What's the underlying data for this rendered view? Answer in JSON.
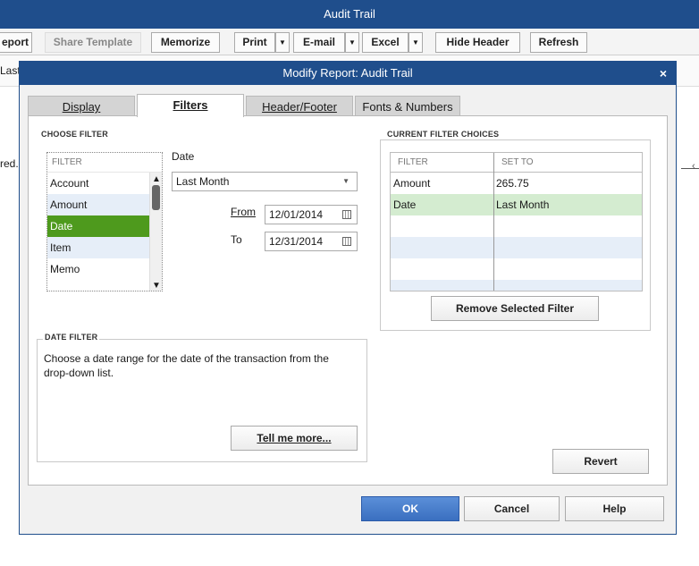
{
  "app": {
    "title": "Audit Trail",
    "toolbar": {
      "report": "eport",
      "share_template": "Share Template",
      "memorize": "Memorize",
      "print": "Print",
      "email": "E-mail",
      "excel": "Excel",
      "hide_header": "Hide Header",
      "refresh": "Refresh"
    },
    "bg_last": "Last",
    "bg_red": "red."
  },
  "dialog": {
    "title": "Modify Report: Audit Trail",
    "close": "×",
    "tabs": [
      {
        "label": "Display"
      },
      {
        "label": "Filters"
      },
      {
        "label": "Header/Footer"
      },
      {
        "label": "Fonts & Numbers"
      }
    ],
    "choose_filter": {
      "section_label": "CHOOSE FILTER",
      "list_header": "FILTER",
      "items": [
        "Account",
        "Amount",
        "Date",
        "Item",
        "Memo"
      ],
      "selected": "Date",
      "date_label": "Date",
      "date_range": "Last Month",
      "from_label": "From",
      "from_value": "12/01/2014",
      "to_label": "To",
      "to_value": "12/31/2014"
    },
    "date_filter": {
      "section_label": "DATE FILTER",
      "description": "Choose a date range for the date of the transaction from the drop-down list.",
      "tell_me_more": "Tell me more..."
    },
    "current_filters": {
      "section_label": "CURRENT FILTER CHOICES",
      "col_filter": "FILTER",
      "col_set_to": "SET TO",
      "rows": [
        {
          "filter": "Amount",
          "set_to": "265.75"
        },
        {
          "filter": "Date",
          "set_to": "Last Month"
        }
      ],
      "remove_button": "Remove Selected Filter"
    },
    "buttons": {
      "revert": "Revert",
      "ok": "OK",
      "cancel": "Cancel",
      "help": "Help"
    }
  }
}
